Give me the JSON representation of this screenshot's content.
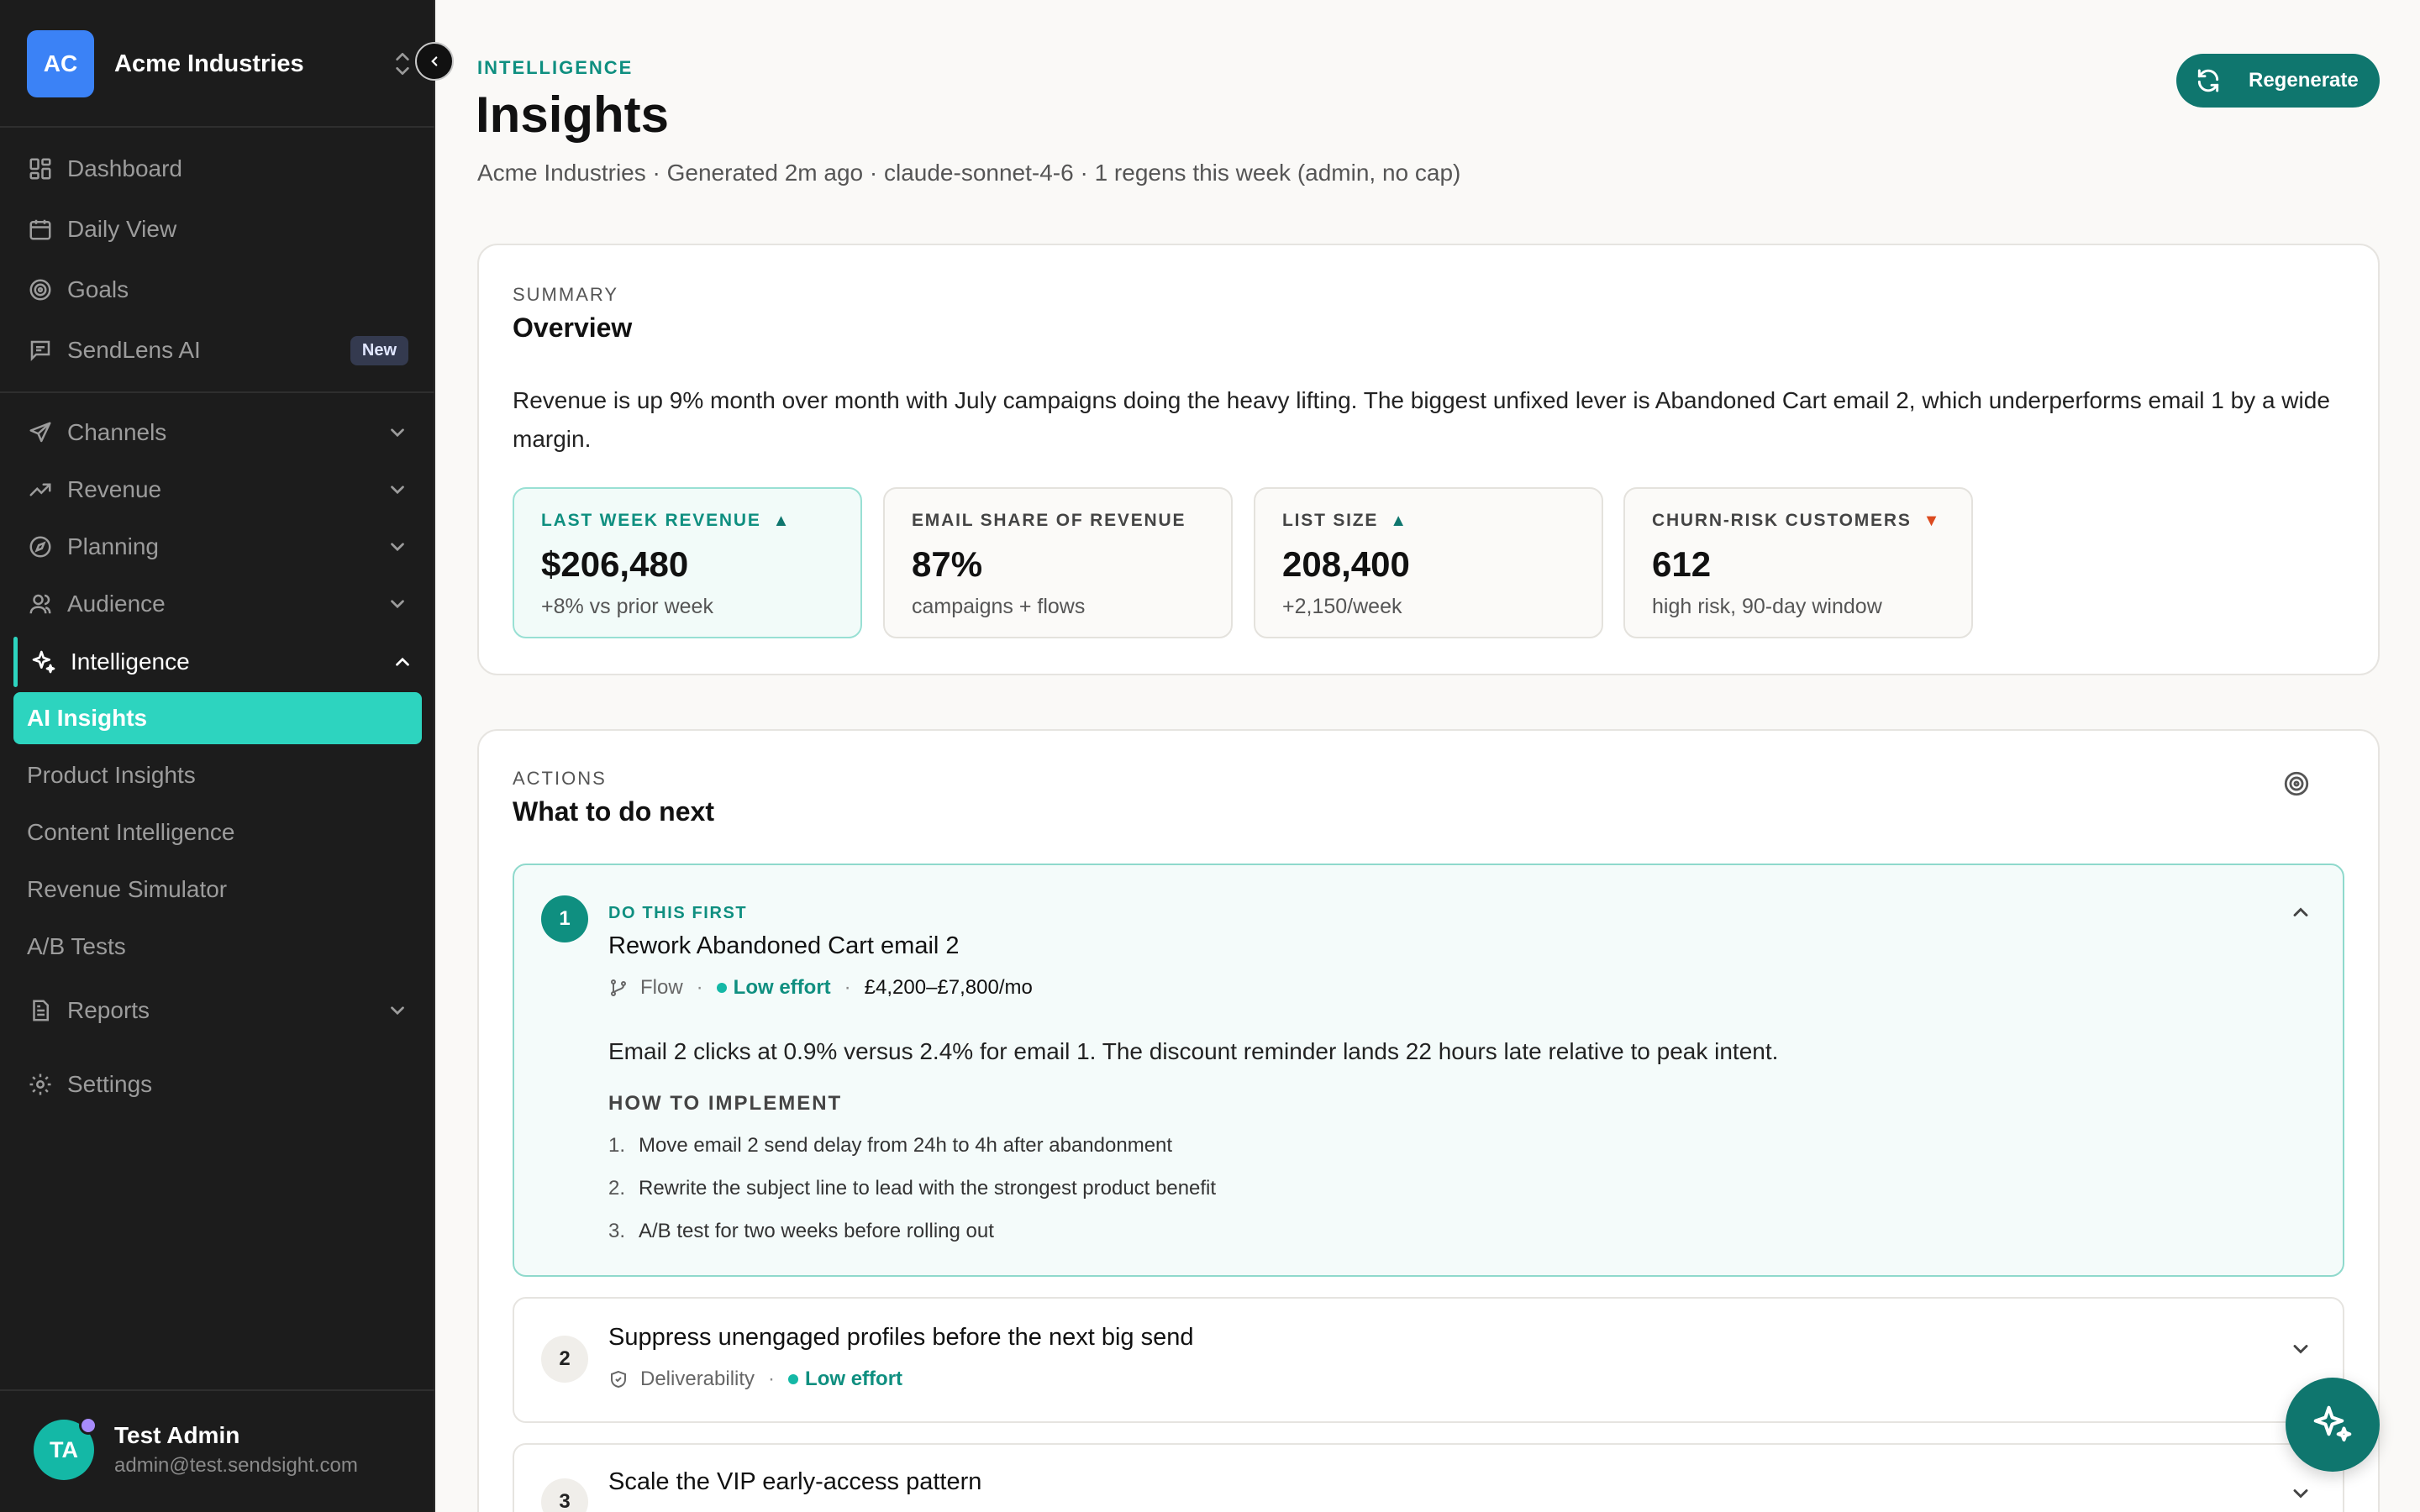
{
  "sidebar": {
    "workspace": {
      "initials": "AC",
      "name": "Acme Industries"
    },
    "items": [
      {
        "label": "Dashboard",
        "icon": "grid-icon"
      },
      {
        "label": "Daily View",
        "icon": "calendar-icon"
      },
      {
        "label": "Goals",
        "icon": "target-icon"
      },
      {
        "label": "SendLens AI",
        "icon": "chat-icon",
        "badge": "New"
      }
    ],
    "groups": [
      {
        "label": "Channels",
        "icon": "send-icon"
      },
      {
        "label": "Revenue",
        "icon": "trending-up-icon"
      },
      {
        "label": "Planning",
        "icon": "compass-icon"
      },
      {
        "label": "Audience",
        "icon": "users-icon"
      },
      {
        "label": "Intelligence",
        "icon": "sparkles-icon",
        "expanded": true
      }
    ],
    "sub_items": [
      "AI Insights",
      "Product Insights",
      "Content Intelligence",
      "Revenue Simulator",
      "A/B Tests"
    ],
    "active_sub_item": "AI Insights",
    "reports": "Reports",
    "settings": "Settings",
    "user": {
      "initials": "TA",
      "name": "Test Admin",
      "email": "admin@test.sendsight.com"
    }
  },
  "header": {
    "eyebrow": "INTELLIGENCE",
    "title": "Insights",
    "meta": "Acme Industries · Generated 2m ago · claude-sonnet-4-6 · 1 regens this week (admin, no cap)",
    "regenerate_label": "Regenerate"
  },
  "summary": {
    "eyebrow": "SUMMARY",
    "title": "Overview",
    "text": "Revenue is up 9% month over month with July campaigns doing the heavy lifting. The biggest unfixed lever is Abandoned Cart email 2, which underperforms email 1 by a wide margin.",
    "stats": [
      {
        "label": "LAST WEEK REVENUE",
        "value": "$206,480",
        "sub": "+8% vs prior week",
        "trend": "up",
        "highlight": true
      },
      {
        "label": "EMAIL SHARE OF REVENUE",
        "value": "87%",
        "sub": "campaigns + flows",
        "trend": "none"
      },
      {
        "label": "LIST SIZE",
        "value": "208,400",
        "sub": "+2,150/week",
        "trend": "up"
      },
      {
        "label": "CHURN-RISK CUSTOMERS",
        "value": "612",
        "sub": "high risk, 90-day window",
        "trend": "down"
      }
    ]
  },
  "actions": {
    "eyebrow": "ACTIONS",
    "title": "What to do next",
    "items": [
      {
        "number": "1",
        "eyebrow": "DO THIS FIRST",
        "title": "Rework Abandoned Cart email 2",
        "category": "Flow",
        "category_icon": "flow-branch-icon",
        "effort": "Low effort",
        "impact": "£4,200–£7,800/mo",
        "description": "Email 2 clicks at 0.9% versus 2.4% for email 1. The discount reminder lands 22 hours late relative to peak intent.",
        "howto_label": "HOW TO IMPLEMENT",
        "steps": [
          "Move email 2 send delay from 24h to 4h after abandonment",
          "Rewrite the subject line to lead with the strongest product benefit",
          "A/B test for two weeks before rolling out"
        ]
      },
      {
        "number": "2",
        "title": "Suppress unengaged profiles before the next big send",
        "category": "Deliverability",
        "category_icon": "shield-icon",
        "effort": "Low effort"
      },
      {
        "number": "3",
        "title": "Scale the VIP early-access pattern"
      }
    ]
  },
  "colors": {
    "accent": "#2dd4bf",
    "primary": "#0f766e",
    "sidebar": "#1c1c1c",
    "down": "#dc4a1f"
  }
}
